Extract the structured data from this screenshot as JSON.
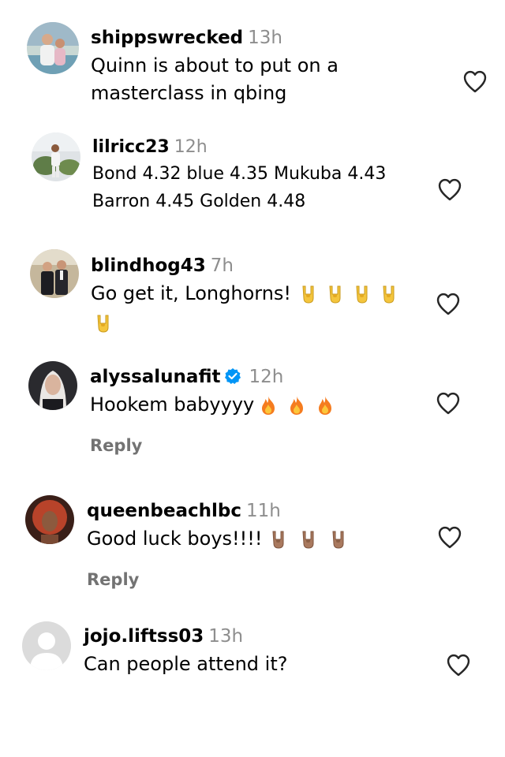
{
  "comments": [
    {
      "username": "shippswrecked",
      "time": "13h",
      "lines": [
        "Quinn is about to put on a",
        "masterclass in qbing"
      ],
      "avatar_icon": "couple-photo-avatar"
    },
    {
      "username": "lilricc23",
      "time": "12h",
      "lines": [
        "Bond 4.32 blue 4.35 Mukuba 4.43",
        "Barron 4.45 Golden 4.48"
      ],
      "avatar_icon": "person-outdoors-avatar"
    },
    {
      "username": "blindhog43",
      "time": "7h",
      "text": "Go get it, Longhorns!",
      "emoji": "horns-sign-emoji",
      "emoji_count": 5,
      "avatar_icon": "couple-formal-avatar"
    },
    {
      "username": "alyssalunafit",
      "time": "12h",
      "text": "Hookem babyyyy",
      "emoji": "fire-emoji",
      "emoji_count": 3,
      "verified": true,
      "reply_label": "Reply",
      "avatar_icon": "woman-portrait-avatar"
    },
    {
      "username": "queenbeachlbc",
      "time": "11h",
      "text": "Good luck boys!!!!",
      "emoji": "horns-sign-dark-emoji",
      "emoji_count": 3,
      "reply_label": "Reply",
      "avatar_icon": "woman-red-hair-avatar"
    },
    {
      "username": "jojo.liftss03",
      "time": "13h",
      "text": "Can people attend it?",
      "avatar_icon": "default-user-avatar"
    }
  ],
  "colors": {
    "timestamp": "#8e8e8e",
    "reply": "#737373",
    "verified": "#0095f6",
    "heart_outline": "#262626"
  }
}
